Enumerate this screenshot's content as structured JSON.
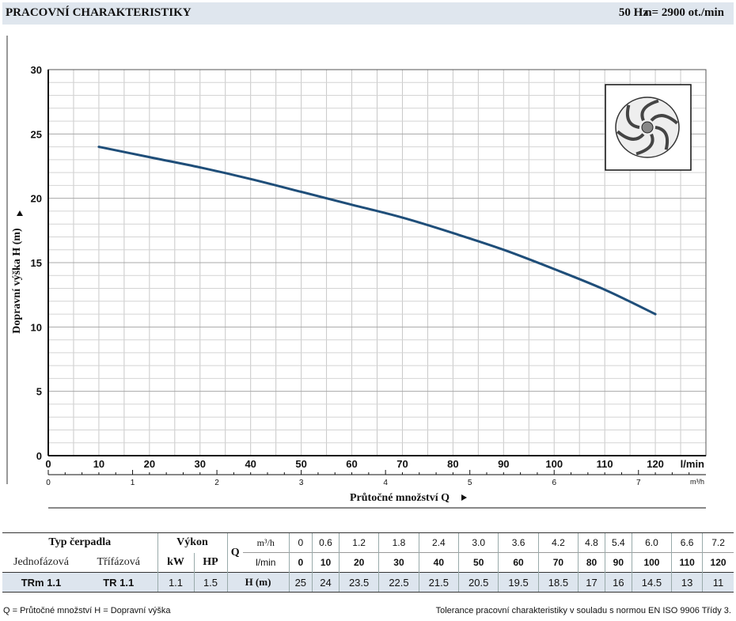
{
  "header": {
    "title": "PRACOVNÍ CHARAKTERISTIKY",
    "frequency": "50 Hz",
    "speed": "n= 2900 ot./min"
  },
  "chart_data": {
    "type": "line",
    "ylabel": "Dopravní výška H (m)",
    "xlabel": "Průtočné množství Q",
    "x_unit": "l/min",
    "x2_unit": "m³/h",
    "xlim": [
      0,
      130
    ],
    "ylim": [
      0,
      30
    ],
    "x_ticks": [
      0,
      10,
      20,
      30,
      40,
      50,
      60,
      70,
      80,
      90,
      100,
      110,
      120
    ],
    "y_ticks": [
      0,
      5,
      10,
      15,
      20,
      25,
      30
    ],
    "x2_ticks": [
      0,
      1,
      2,
      3,
      4,
      5,
      6,
      7
    ],
    "grid": true,
    "series": [
      {
        "x": [
          10,
          20,
          30,
          40,
          50,
          60,
          70,
          80,
          90,
          100,
          110,
          120
        ],
        "y": [
          24,
          23.2,
          22.4,
          21.5,
          20.5,
          19.5,
          18.5,
          17.3,
          16,
          14.5,
          12.9,
          11
        ]
      }
    ],
    "color": "#1f4e79"
  },
  "impeller_icon": "impeller-icon",
  "table": {
    "type_label": "Typ čerpadla",
    "single_phase": "Jednofázová",
    "three_phase": "Třífázová",
    "power_label": "Výkon",
    "kw": "kW",
    "hp": "HP",
    "q": "Q",
    "m3h": "m³/h",
    "lmin": "l/min",
    "h": "H (m)",
    "m3h_values": [
      "0",
      "0.6",
      "1.2",
      "1.8",
      "2.4",
      "3.0",
      "3.6",
      "4.2",
      "4.8",
      "5.4",
      "6.0",
      "6.6",
      "7.2"
    ],
    "lmin_values": [
      "0",
      "10",
      "20",
      "30",
      "40",
      "50",
      "60",
      "70",
      "80",
      "90",
      "100",
      "110",
      "120"
    ],
    "model_single": "TRm 1.1",
    "model_three": "TR 1.1",
    "kw_value": "1.1",
    "hp_value": "1.5",
    "h_values": [
      "25",
      "24",
      "23.5",
      "22.5",
      "21.5",
      "20.5",
      "19.5",
      "18.5",
      "17",
      "16",
      "14.5",
      "13",
      "11"
    ]
  },
  "footer": {
    "legend": "Q = Průtočné množství   H = Dopravní výška",
    "tolerance": "Tolerance pracovní charakteristiky v souladu s normou EN ISO 9906 Třídy 3."
  }
}
